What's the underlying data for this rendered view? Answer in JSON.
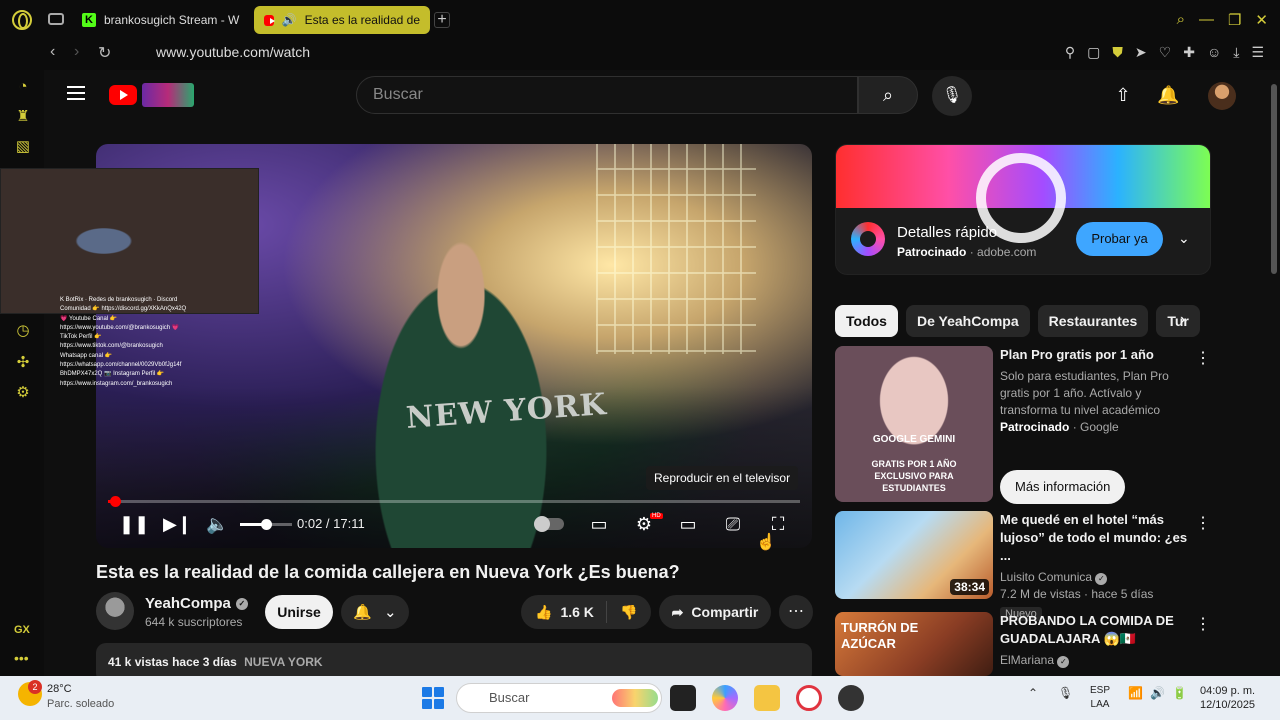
{
  "browser": {
    "tabs": [
      {
        "label": "brankosugich Stream - W",
        "active": false,
        "icon": "kick-icon"
      },
      {
        "label": "Esta es la realidad de",
        "active": true,
        "icon": "youtube-icon"
      }
    ],
    "url": "www.youtube.com/watch",
    "accent_color": "#d4cd3a"
  },
  "youtube": {
    "search_placeholder": "Buscar"
  },
  "player": {
    "tooltip": "Reproducir en el televisor",
    "time": "0:02 / 17:11",
    "progress_fraction": 0.002,
    "volume_fraction": 0.5,
    "hd_label": "HD",
    "overlay_text": "NEW YORK"
  },
  "stream_overlay": {
    "lines": [
      "K BotRix · Redes de brankosugich · Discord",
      "Comunidad 👉 https://discord.gg/XKkAnQx42Q",
      "💗 Youtube Canal 👉",
      "https://www.youtube.com/@brankosugich 💗",
      "TikTok Perfil 👉",
      "https://www.tiktok.com/@brankosugich",
      "Whatsapp canal 👉",
      "https://whatsapp.com/channel/0029Vb0fJg14f",
      "BhDMPX47x2Q 📷 Instagram Perfil 👉",
      "https://www.instagram.com/_brankosugich"
    ]
  },
  "video": {
    "title": "Esta es la realidad de la comida callejera en Nueva York ¿Es buena?",
    "channel": "YeahCompa",
    "subscribers": "644 k suscriptores",
    "join_label": "Unirse",
    "likes": "1.6 K",
    "share_label": "Compartir",
    "views": "41 k vistas",
    "date": "hace 3 días",
    "location_tag": "NUEVA YORK"
  },
  "ad": {
    "title": "Detalles rápido",
    "sponsor_label": "Patrocinado",
    "domain": "adobe.com",
    "cta": "Probar ya"
  },
  "chips": [
    "Todos",
    "De YeahCompa",
    "Restaurantes",
    "Tur"
  ],
  "recommendations": [
    {
      "title": "Plan Pro gratis por 1 año",
      "description": "Solo para estudiantes, Plan Pro gratis por 1 año. Actívalo y transforma tu nivel académico",
      "sponsor": "Patrocinado",
      "advertiser": "Google",
      "cta": "Más información",
      "thumb_text_1": "GOOGLE GEMINI",
      "thumb_text_2": "GRATIS POR 1 AÑO EXCLUSIVO PARA ESTUDIANTES"
    },
    {
      "title": "Me quedé en el hotel “más lujoso” de todo el mundo: ¿es ...",
      "channel": "Luisito Comunica",
      "meta": "7.2 M de vistas · hace 5 días",
      "badge": "Nuevo",
      "duration": "38:34"
    },
    {
      "title": "PROBANDO LA COMIDA DE GUADALAJARA 😱🇲🇽",
      "channel": "ElMariana",
      "thumb_text": "TURRÓN DE AZÚCAR"
    }
  ],
  "taskbar": {
    "weather_temp": "28°C",
    "weather_desc": "Parc. soleado",
    "weather_badge": "2",
    "search_placeholder": "Buscar",
    "lang_1": "ESP",
    "lang_2": "LAA",
    "time": "04:09 p. m.",
    "date": "12/10/2025"
  }
}
